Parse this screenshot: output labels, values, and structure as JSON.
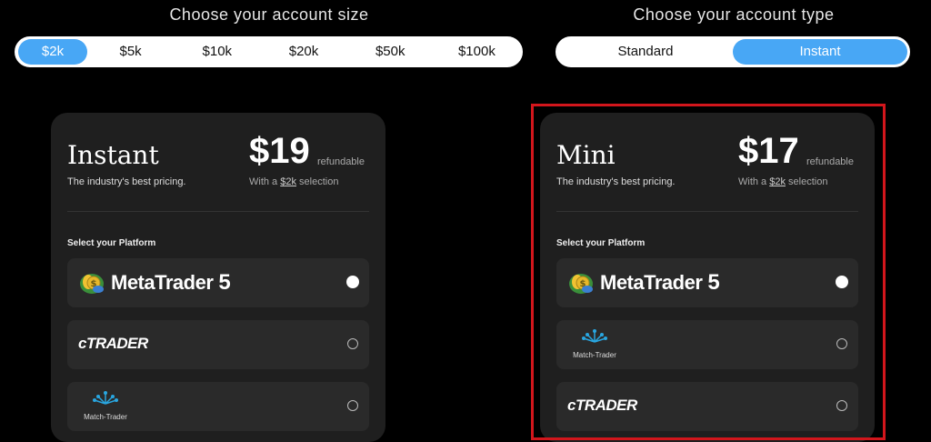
{
  "size_section": {
    "heading": "Choose your account size",
    "options": [
      "$2k",
      "$5k",
      "$10k",
      "$20k",
      "$50k",
      "$100k"
    ],
    "selected": "$2k"
  },
  "type_section": {
    "heading": "Choose your account type",
    "options": [
      "Standard",
      "Instant"
    ],
    "selected": "Instant"
  },
  "cards": [
    {
      "name": "Instant",
      "subtitle": "The industry's best pricing.",
      "price": "$19",
      "price_note": "refundable",
      "with_prefix": "With a ",
      "with_value": "$2k",
      "with_suffix": " selection",
      "platform_label": "Select your Platform",
      "platforms": [
        {
          "name": "MetaTrader",
          "suffix": "5",
          "selected": true
        },
        {
          "name": "cTRADER",
          "selected": false
        },
        {
          "name": "Match-Trader",
          "selected": false
        }
      ]
    },
    {
      "name": "Mini",
      "subtitle": "The industry's best pricing.",
      "price": "$17",
      "price_note": "refundable",
      "with_prefix": "With a ",
      "with_value": "$2k",
      "with_suffix": " selection",
      "platform_label": "Select your Platform",
      "platforms": [
        {
          "name": "MetaTrader",
          "suffix": "5",
          "selected": true
        },
        {
          "name": "Match-Trader",
          "selected": false
        },
        {
          "name": "cTRADER",
          "selected": false
        }
      ]
    }
  ],
  "colors": {
    "accent": "#48a7f5",
    "highlight_border": "#d2161c",
    "card_bg": "#1f1f1f"
  }
}
